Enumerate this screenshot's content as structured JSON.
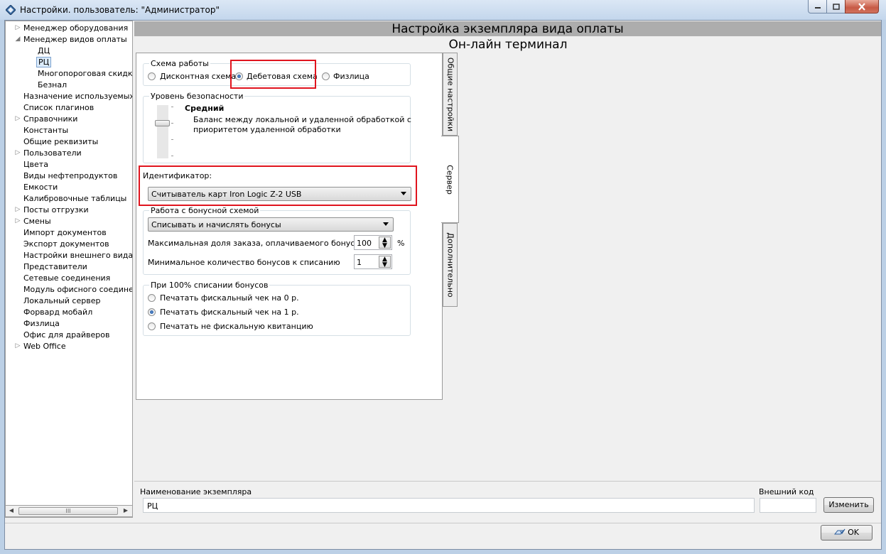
{
  "window": {
    "title": "Настройки. пользователь: \"Администратор\""
  },
  "tree": {
    "items": [
      {
        "label": "Менеджер оборудования",
        "expander": "▷",
        "level": 0
      },
      {
        "label": "Менеджер видов оплаты",
        "expander": "◢",
        "level": 0
      },
      {
        "label": "ДЦ",
        "expander": "",
        "level": 1
      },
      {
        "label": "РЦ",
        "expander": "",
        "level": 1,
        "selected": true
      },
      {
        "label": "Многопороговая скидка",
        "expander": "",
        "level": 1
      },
      {
        "label": "Безнал",
        "expander": "",
        "level": 1
      },
      {
        "label": "Назначение используемых ус",
        "expander": "",
        "level": 0
      },
      {
        "label": "Список плагинов",
        "expander": "",
        "level": 0
      },
      {
        "label": "Справочники",
        "expander": "▷",
        "level": 0
      },
      {
        "label": "Константы",
        "expander": "",
        "level": 0
      },
      {
        "label": "Общие реквизиты",
        "expander": "",
        "level": 0
      },
      {
        "label": "Пользователи",
        "expander": "▷",
        "level": 0
      },
      {
        "label": "Цвета",
        "expander": "",
        "level": 0
      },
      {
        "label": "Виды нефтепродуктов",
        "expander": "",
        "level": 0
      },
      {
        "label": "Емкости",
        "expander": "",
        "level": 0
      },
      {
        "label": "Калибровочные таблицы",
        "expander": "",
        "level": 0
      },
      {
        "label": "Посты отгрузки",
        "expander": "▷",
        "level": 0
      },
      {
        "label": "Смены",
        "expander": "▷",
        "level": 0
      },
      {
        "label": "Импорт документов",
        "expander": "",
        "level": 0
      },
      {
        "label": "Экспорт документов",
        "expander": "",
        "level": 0
      },
      {
        "label": "Настройки внешнего вида",
        "expander": "",
        "level": 0
      },
      {
        "label": "Представители",
        "expander": "",
        "level": 0
      },
      {
        "label": "Сетевые соединения",
        "expander": "",
        "level": 0
      },
      {
        "label": "Модуль офисного соединения",
        "expander": "",
        "level": 0
      },
      {
        "label": "Локальный сервер",
        "expander": "",
        "level": 0
      },
      {
        "label": "Форвард мобайл",
        "expander": "",
        "level": 0
      },
      {
        "label": "Физлица",
        "expander": "",
        "level": 0
      },
      {
        "label": "Офис для драйверов",
        "expander": "",
        "level": 0
      },
      {
        "label": "Web Office",
        "expander": "▷",
        "level": 0
      }
    ],
    "scroll_thumb_glyph": "III"
  },
  "header": {
    "title": "Настройка экземпляра вида оплаты",
    "subtitle": "Он-лайн терминал"
  },
  "scheme": {
    "title": "Схема работы",
    "options": [
      "Дисконтная схема",
      "Дебетовая схема",
      "Физлица"
    ],
    "selected": "Дебетовая схема"
  },
  "security": {
    "title": "Уровень безопасности",
    "level_name": "Средний",
    "description_line1": "Баланс между локальной и удаленной обработкой с",
    "description_line2": "приоритетом удаленной обработки"
  },
  "identifier": {
    "label": "Идентификатор:",
    "value": "Считыватель карт Iron Logic Z-2 USB"
  },
  "bonus": {
    "title": "Работа с бонусной схемой",
    "mode": "Списывать и начислять бонусы",
    "max_share_label": "Максимальная доля заказа, оплачиваемого бонусами",
    "max_share_value": "100",
    "max_share_unit": "%",
    "min_count_label": "Минимальное количество бонусов к списанию",
    "min_count_value": "1"
  },
  "full_writeoff": {
    "title": "При 100% списании бонусов",
    "options": [
      "Печатать фискальный чек на 0 р.",
      "Печатать фискальный чек на 1 р.",
      "Печатать не фискальную квитанцию"
    ],
    "selected": "Печатать фискальный чек на 1 р."
  },
  "tabs": [
    "Общие настройки",
    "Сервер",
    "Дополнительно"
  ],
  "instance": {
    "name_label": "Наименование экземпляра",
    "name_value": "РЦ",
    "code_label": "Внешний код",
    "code_value": "",
    "change_button": "Изменить"
  },
  "ok_button": "OK",
  "colors": {
    "highlight": "#e0141e",
    "selection": "#dcecfc"
  }
}
